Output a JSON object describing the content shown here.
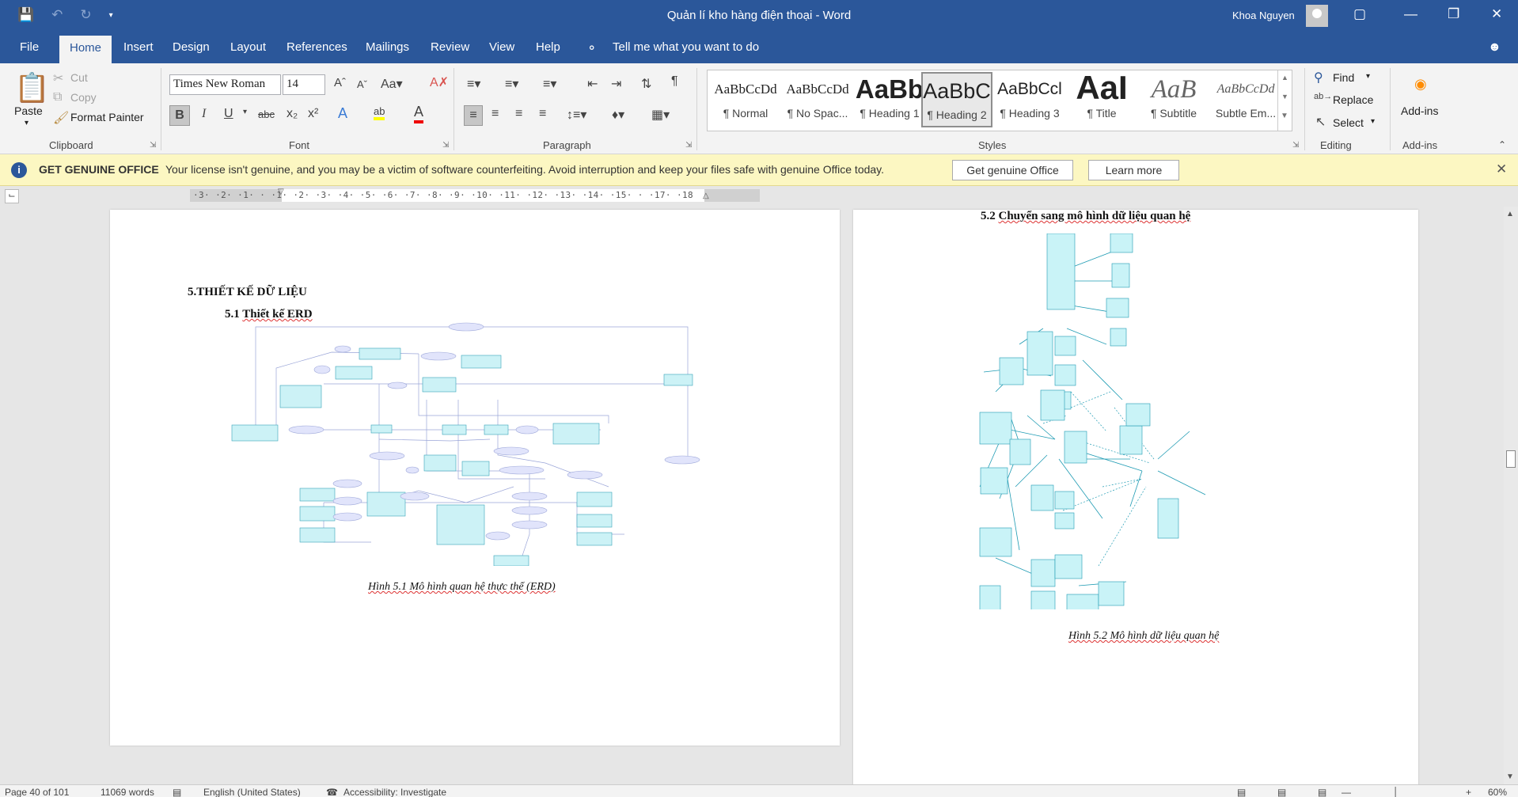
{
  "window": {
    "title": "Quản lí kho hàng điện thoại  -  Word",
    "user": "Khoa Nguyen"
  },
  "tabs": [
    "File",
    "Home",
    "Insert",
    "Design",
    "Layout",
    "References",
    "Mailings",
    "Review",
    "View",
    "Help"
  ],
  "active_tab": "Home",
  "tell_me": "Tell me what you want to do",
  "clipboard": {
    "paste": "Paste",
    "cut": "Cut",
    "copy": "Copy",
    "format_painter": "Format Painter",
    "label": "Clipboard"
  },
  "font": {
    "family": "Times New Roman",
    "size": "14",
    "label": "Font"
  },
  "paragraph": {
    "label": "Paragraph"
  },
  "styles": {
    "label": "Styles",
    "items": [
      {
        "sample": "AaBbCcDd",
        "name": "¶ Normal"
      },
      {
        "sample": "AaBbCcDd",
        "name": "¶ No Spac..."
      },
      {
        "sample": "AaBb",
        "name": "¶ Heading 1"
      },
      {
        "sample": "AaBbC",
        "name": "¶ Heading 2"
      },
      {
        "sample": "AaBbCcl",
        "name": "¶ Heading 3"
      },
      {
        "sample": "AaI",
        "name": "¶ Title"
      },
      {
        "sample": "AaB",
        "name": "¶ Subtitle"
      },
      {
        "sample": "AaBbCcDd",
        "name": "Subtle Em..."
      }
    ],
    "selected": "¶ Heading 2"
  },
  "editing": {
    "find": "Find",
    "replace": "Replace",
    "select": "Select",
    "label": "Editing"
  },
  "addins": {
    "button": "Add-ins",
    "label": "Add-ins"
  },
  "license_bar": {
    "title": "GET GENUINE OFFICE",
    "message": "Your license isn't genuine, and you may be a victim of software counterfeiting. Avoid interruption and keep your files safe with genuine Office today.",
    "button_primary": "Get genuine Office",
    "button_secondary": "Learn more"
  },
  "ruler_ticks": "·3·  ·2·  ·1·  ·  ·1·  ·2·  ·3·  ·4·  ·5·  ·6·  ·7·  ·8·  ·9·  ·10· ·11· ·12· ·13· ·14· ·15· ·  ·17· ·18",
  "page_left": {
    "heading1": "5.THIẾT KẾ DỮ LIỆU",
    "heading2_number": "5.1 ",
    "heading2_text": "Thiết kế ERD",
    "caption": "Hình 5.1 Mô hình quan hệ thực thể (ERD)"
  },
  "page_right": {
    "heading2_number": "5.2 ",
    "heading2_text": "Chuyển sang mô hình dữ liệu quan hệ",
    "caption": "Hình 5.2 Mô hình dữ liệu quan hệ"
  },
  "status": {
    "page": "Page 40 of 101",
    "words": "11069 words",
    "language": "English (United States)",
    "accessibility": "Accessibility: Investigate",
    "zoom": "60%"
  }
}
